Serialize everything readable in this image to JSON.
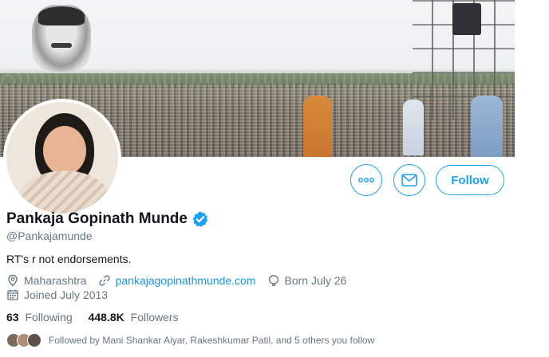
{
  "profile": {
    "name": "Pankaja Gopinath Munde",
    "handle": "@Pankajamunde",
    "bio": "RT's r not endorsements.",
    "location": "Maharashtra",
    "website": "pankajagopinathmunde.com",
    "born": "Born July 26",
    "joined": "Joined July 2013",
    "verified": true
  },
  "stats": {
    "following_count": "63",
    "following_label": "Following",
    "followers_count": "448.8K",
    "followers_label": "Followers"
  },
  "actions": {
    "follow_label": "Follow",
    "more_icon": "more-icon",
    "message_icon": "envelope-icon"
  },
  "followed_by": "Followed by Mani Shankar Aiyar, Rakeshkumar Patil, and 5 others you follow",
  "colors": {
    "accent": "#1da1f2",
    "link": "#1b95e0",
    "secondary_text": "#657786",
    "primary_text": "#14171a"
  }
}
